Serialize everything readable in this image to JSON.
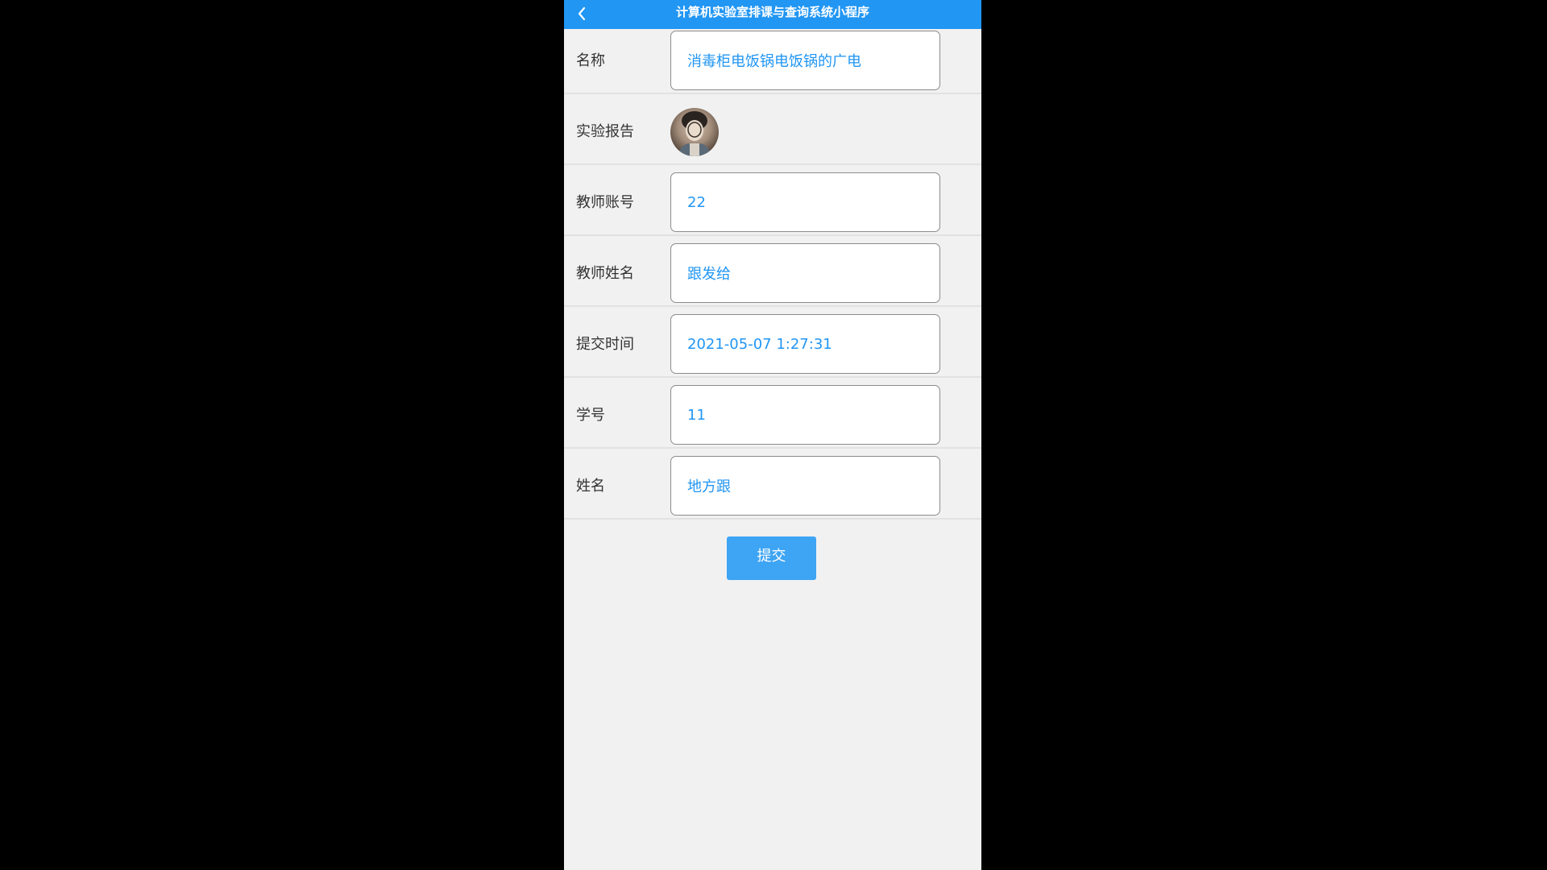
{
  "header": {
    "title": "计算机实验室排课与查询系统小程序",
    "back_icon": "chevron-left-icon"
  },
  "form": {
    "name": {
      "label": "名称",
      "value": "消毒柜电饭锅电饭锅的广电"
    },
    "report": {
      "label": "实验报告",
      "image": "report-thumbnail"
    },
    "teacher_account": {
      "label": "教师账号",
      "value": "22"
    },
    "teacher_name": {
      "label": "教师姓名",
      "value": "跟发给"
    },
    "submit_time": {
      "label": "提交时间",
      "value": "2021-05-07 1:27:31"
    },
    "student_id": {
      "label": "学号",
      "value": "11"
    },
    "student_name": {
      "label": "姓名",
      "value": "地方跟"
    }
  },
  "actions": {
    "submit_label": "提交"
  },
  "colors": {
    "primary": "#2196f3",
    "button": "#3ea4f4",
    "background": "#f1f1f1",
    "value_text": "#2196f3"
  }
}
